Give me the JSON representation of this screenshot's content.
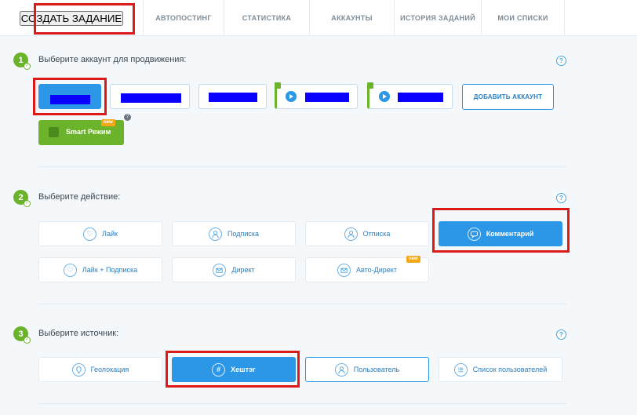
{
  "nav": {
    "tabs": [
      {
        "label": "СОЗДАТЬ ЗАДАНИЕ"
      },
      {
        "label": "АВТОПОСТИНГ"
      },
      {
        "label": "СТАТИСТИКА"
      },
      {
        "label": "АККАУНТЫ"
      },
      {
        "label": "ИСТОРИЯ ЗАДАНИЙ"
      },
      {
        "label": "МОИ СПИСКИ"
      }
    ]
  },
  "step1": {
    "number": "1",
    "title": "Выберите аккаунт для продвижения:",
    "help": "?",
    "add_account": "ДОБАВИТЬ АККАУНТ",
    "smart_mode": "Smart Режим",
    "smart_badge": "new",
    "smart_help": "?"
  },
  "step2": {
    "number": "2",
    "title": "Выберите действие:",
    "help": "?",
    "actions": [
      {
        "label": "Лайк",
        "icon": "heart-icon"
      },
      {
        "label": "Подписка",
        "icon": "user-add-icon"
      },
      {
        "label": "Отписка",
        "icon": "user-remove-icon"
      },
      {
        "label": "Комментарий",
        "icon": "comment-icon"
      },
      {
        "label": "Лайк + Подписка",
        "icon": "heart-plus-icon"
      },
      {
        "label": "Директ",
        "icon": "mail-icon"
      },
      {
        "label": "Авто-Директ",
        "icon": "auto-mail-icon"
      }
    ],
    "auto_direct_badge": "new"
  },
  "step3": {
    "number": "3",
    "title": "Выберите источник:",
    "help": "?",
    "sources": [
      {
        "label": "Геолокация",
        "icon": "location-pin-icon"
      },
      {
        "label": "Хештэг",
        "icon": "hashtag-icon"
      },
      {
        "label": "Пользователь",
        "icon": "user-icon"
      },
      {
        "label": "Список пользователей",
        "icon": "list-icon"
      }
    ]
  },
  "colors": {
    "accent": "#2b97e6",
    "green": "#6bb32a",
    "highlight": "#dc1a1a",
    "badge": "#f3a817"
  }
}
